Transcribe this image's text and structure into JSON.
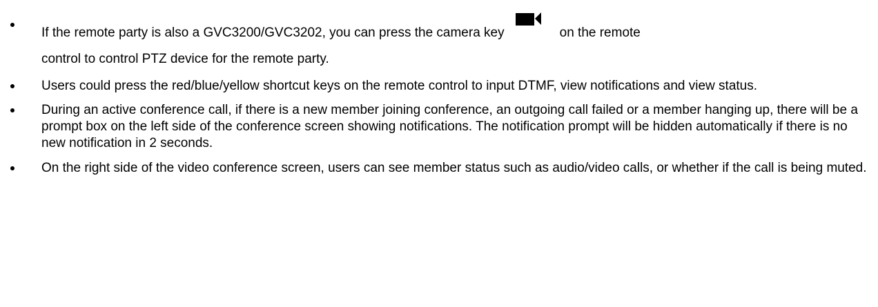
{
  "bullets": [
    {
      "before_icon": "If the remote party is also a GVC3200/GVC3202, you can press the camera key",
      "icon": "camera-icon",
      "after_icon": "on the remote",
      "line2": "control to control PTZ device for the remote party."
    },
    {
      "text": "Users could press the red/blue/yellow shortcut keys on the remote control to input DTMF, view notifications and view status."
    },
    {
      "text": "During an active conference call, if there is a new member joining conference, an outgoing call failed or a member hanging up, there will be a prompt box on the left side of the conference screen showing notifications. The notification prompt will be hidden automatically if there is no new notification in 2 seconds."
    },
    {
      "text": "On the right side of the video conference screen, users can see member status such as audio/video calls, or whether if the call is being muted."
    }
  ]
}
